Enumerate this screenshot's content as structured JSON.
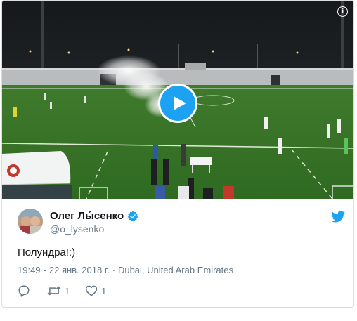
{
  "tweet": {
    "author": {
      "display_name": "Олег Лы́сенко",
      "username": "@o_lysenko",
      "verified": true,
      "avatar": "avatar-photo"
    },
    "text": "Полундра!:)",
    "time": "19:49",
    "separator": "-",
    "date": "22 янв. 2018 г.",
    "dot": "·",
    "location": "Dubai, United Arab Emirates",
    "actions": {
      "reply_icon": "reply-icon",
      "retweet_icon": "retweet-icon",
      "retweet_count": "1",
      "like_icon": "heart-icon",
      "like_count": "1"
    }
  },
  "media": {
    "type": "video",
    "play_icon": "play-icon",
    "info_icon": "info-icon",
    "info_glyph": "i"
  },
  "colors": {
    "twitter_blue": "#1da1f2",
    "text_primary": "#14171a",
    "text_secondary": "#657786",
    "border": "#d9dde0"
  }
}
